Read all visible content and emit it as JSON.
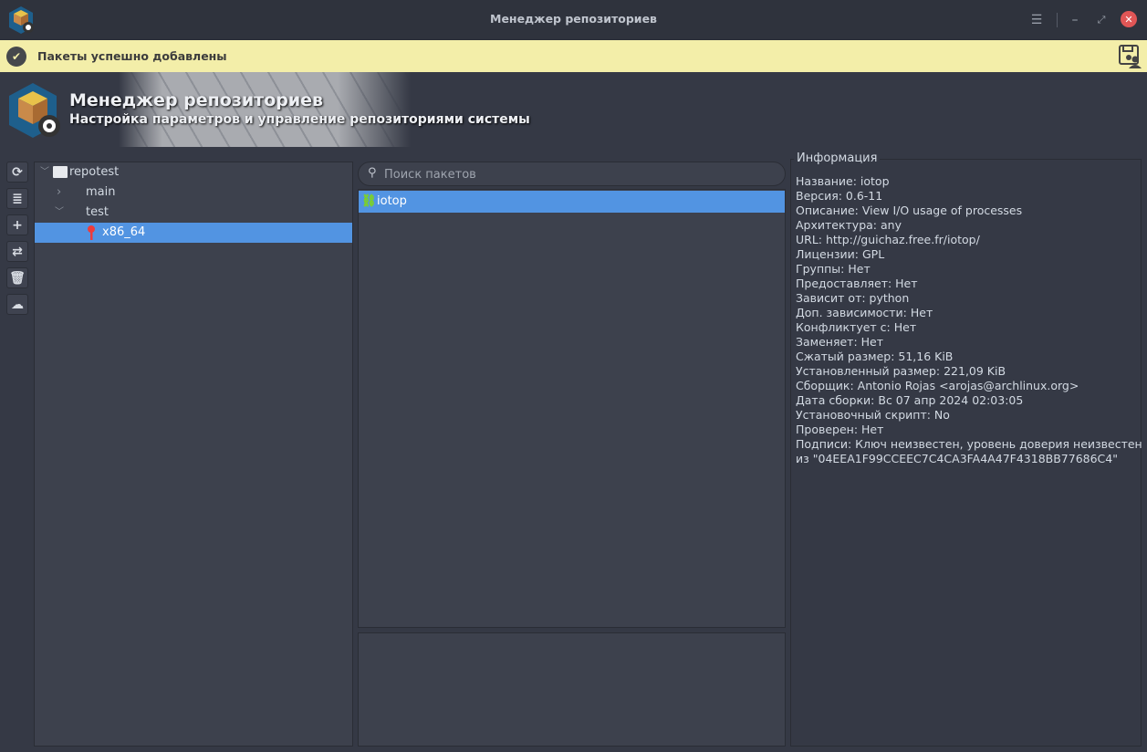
{
  "window": {
    "title": "Менеджер репозиториев"
  },
  "notification": {
    "message": "Пакеты успешно добавлены"
  },
  "banner": {
    "title": "Менеджер репозиториев",
    "subtitle": "Настройка параметров и управление репозиториями системы"
  },
  "toolbar": [
    "refresh-icon",
    "database-icon",
    "add-icon",
    "sync-icon",
    "trash-icon",
    "upload-icon"
  ],
  "tree": {
    "root": "repotest",
    "items": [
      {
        "label": "main",
        "expanded": false
      },
      {
        "label": "test",
        "expanded": true
      }
    ],
    "leaf": "x86_64"
  },
  "search": {
    "placeholder": "Поиск пакетов",
    "value": ""
  },
  "packages": [
    {
      "name": "iotop"
    }
  ],
  "info": {
    "title": "Информация",
    "lines": [
      "Название: iotop",
      "Версия: 0.6-11",
      "Описание: View I/O usage of processes",
      "Архитектура: any",
      "URL: http://guichaz.free.fr/iotop/",
      "Лицензии: GPL",
      "Группы: Нет",
      "Предоставляет: Нет",
      "Зависит от: python",
      "Доп. зависимости: Нет",
      "Конфликтует с: Нет",
      "Заменяет: Нет",
      "Сжатый размер: 51,16 KiB",
      "Установленный размер: 221,09 KiB",
      "Сборщик: Antonio Rojas <arojas@archlinux.org>",
      "Дата сборки: Вс 07 апр 2024 02:03:05",
      "Установочный скрипт: No",
      "Проверен: Нет",
      "Подписи: Ключ неизвестен, уровень доверия неизвестен",
      "из \"04EEA1F99CCEEC7C4CA3FA4A47F4318BB77686C4\""
    ]
  },
  "colors": {
    "accent": "#5294e2",
    "notify_bg": "#f3eea9",
    "close": "#e05656"
  }
}
